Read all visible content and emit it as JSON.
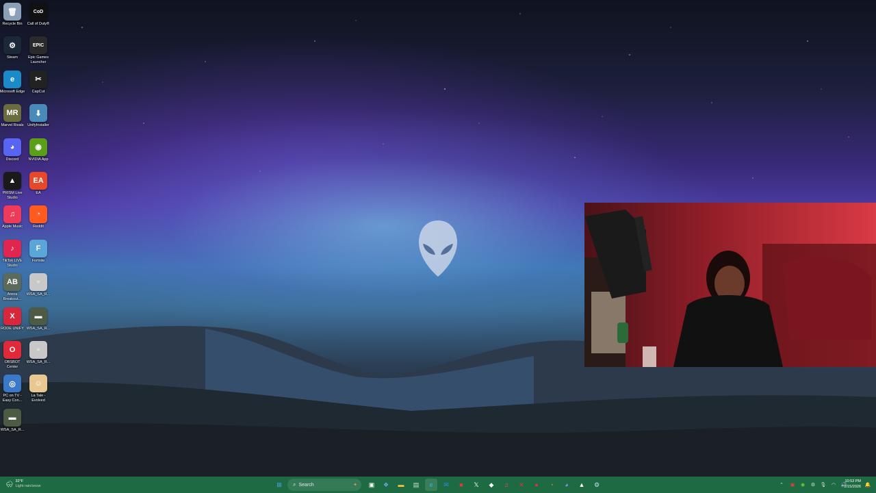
{
  "desktop": {
    "icons": [
      {
        "label": "Recycle Bin",
        "glyph": "🗑",
        "color": "#8aa0b8"
      },
      {
        "label": "Call of Duty®",
        "glyph": "CoD",
        "color": "#111111"
      },
      {
        "label": "Steam",
        "glyph": "⚙",
        "color": "#1b2838"
      },
      {
        "label": "Epic Games Launcher",
        "glyph": "EPIC",
        "color": "#2a2a2a"
      },
      {
        "label": "Microsoft Edge",
        "glyph": "e",
        "color": "#1a8ac8"
      },
      {
        "label": "CapCut",
        "glyph": "✂",
        "color": "#222222"
      },
      {
        "label": "Marvel Rivals",
        "glyph": "MR",
        "color": "#6b6b40"
      },
      {
        "label": "UnifyInstaller",
        "glyph": "⬇",
        "color": "#4a8ab8"
      },
      {
        "label": "Discord",
        "glyph": "◕",
        "color": "#5865f2"
      },
      {
        "label": "NVIDIA App",
        "glyph": "◉",
        "color": "#5b9e1a"
      },
      {
        "label": "PRISM Live Studio",
        "glyph": "▲",
        "color": "#1a1a1a"
      },
      {
        "label": "EA",
        "glyph": "EA",
        "color": "#e5482a"
      },
      {
        "label": "Apple Music",
        "glyph": "♫",
        "color": "#f03a5a"
      },
      {
        "label": "Reddit",
        "glyph": "◔",
        "color": "#ff5a1f"
      },
      {
        "label": "TikTok LIVE Studio",
        "glyph": "♪",
        "color": "#e0254e"
      },
      {
        "label": "Fortnite",
        "glyph": "F",
        "color": "#5aa6d8"
      },
      {
        "label": "Arena Breakout...",
        "glyph": "AB",
        "color": "#5b6a5a"
      },
      {
        "label": "WSA_SA_R...",
        "glyph": "▫",
        "color": "#c8c8c8"
      },
      {
        "label": "RODE UNIFY",
        "glyph": "X",
        "color": "#d8263a"
      },
      {
        "label": "WSA_SA_R...",
        "glyph": "▬",
        "color": "#4d5a44"
      },
      {
        "label": "OBSBOT Center",
        "glyph": "O",
        "color": "#e02a3a"
      },
      {
        "label": "WSA_SA_R...",
        "glyph": "▫",
        "color": "#c8c8c8"
      },
      {
        "label": "PC on TV - Easy Con...",
        "glyph": "◎",
        "color": "#3a78c8"
      },
      {
        "label": "La Tale - Evolved",
        "glyph": "☺",
        "color": "#e8c890"
      },
      {
        "label": "WSA_SA_R...",
        "glyph": "▬",
        "color": "#4d5a44"
      }
    ]
  },
  "taskbar": {
    "weather": {
      "temp": "32°F",
      "condition": "Light rain/snow"
    },
    "search_placeholder": "Search",
    "clock": {
      "time": "10:53 PM",
      "date": "2/15/2026"
    },
    "apps": [
      "start-icon",
      "widgets-icon",
      "task-view-icon",
      "copilot-icon",
      "file-explorer-icon",
      "microsoft-store-icon",
      "edge-icon",
      "outlook-icon",
      "media-icon",
      "x-icon",
      "unity-icon",
      "music-icon",
      "rode-icon",
      "obsbot-icon",
      "reddit-icon",
      "discord-icon",
      "prism-icon",
      "steam-icon"
    ]
  },
  "colors": {
    "taskbar": "#1e6b43",
    "accent": "#d8333d"
  }
}
